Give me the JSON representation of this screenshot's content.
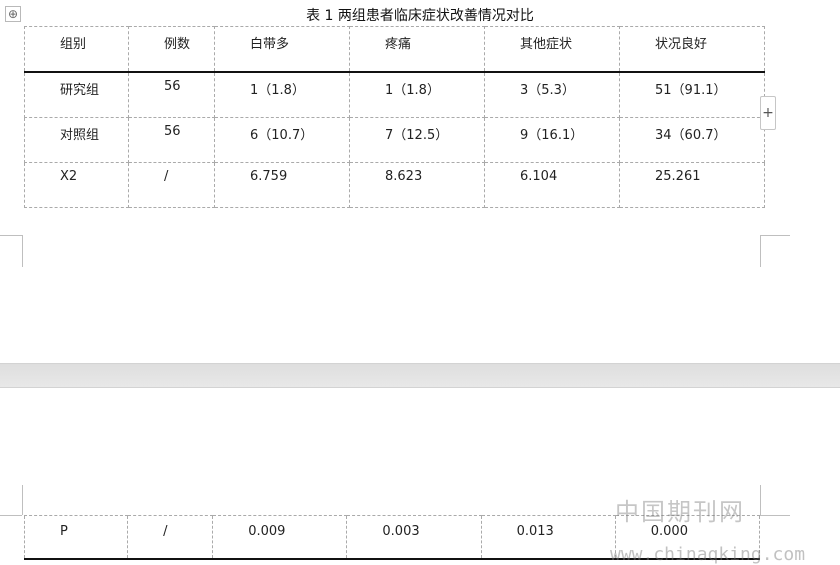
{
  "table": {
    "caption": "表 1 两组患者临床症状改善情况对比",
    "headers": [
      "组别",
      "例数",
      "白带多",
      "疼痛",
      "其他症状",
      "状况良好"
    ],
    "rows": [
      [
        "研究组",
        "56",
        "1（1.8）",
        "1（1.8）",
        "3（5.3）",
        "51（91.1）"
      ],
      [
        "对照组",
        "56",
        "6（10.7）",
        "7（12.5）",
        "9（16.1）",
        "34（60.7）"
      ],
      [
        "X2",
        "/",
        "6.759",
        "8.623",
        "6.104",
        "25.261"
      ]
    ],
    "continued_rows": [
      [
        "P",
        "/",
        "0.009",
        "0.003",
        "0.013",
        "0.000"
      ]
    ]
  },
  "controls": {
    "move_handle_icon": "move-icon",
    "add_column_icon": "plus-icon"
  },
  "watermark": {
    "site_name": "中国期刊网",
    "url": "www.chinaqking.com"
  }
}
